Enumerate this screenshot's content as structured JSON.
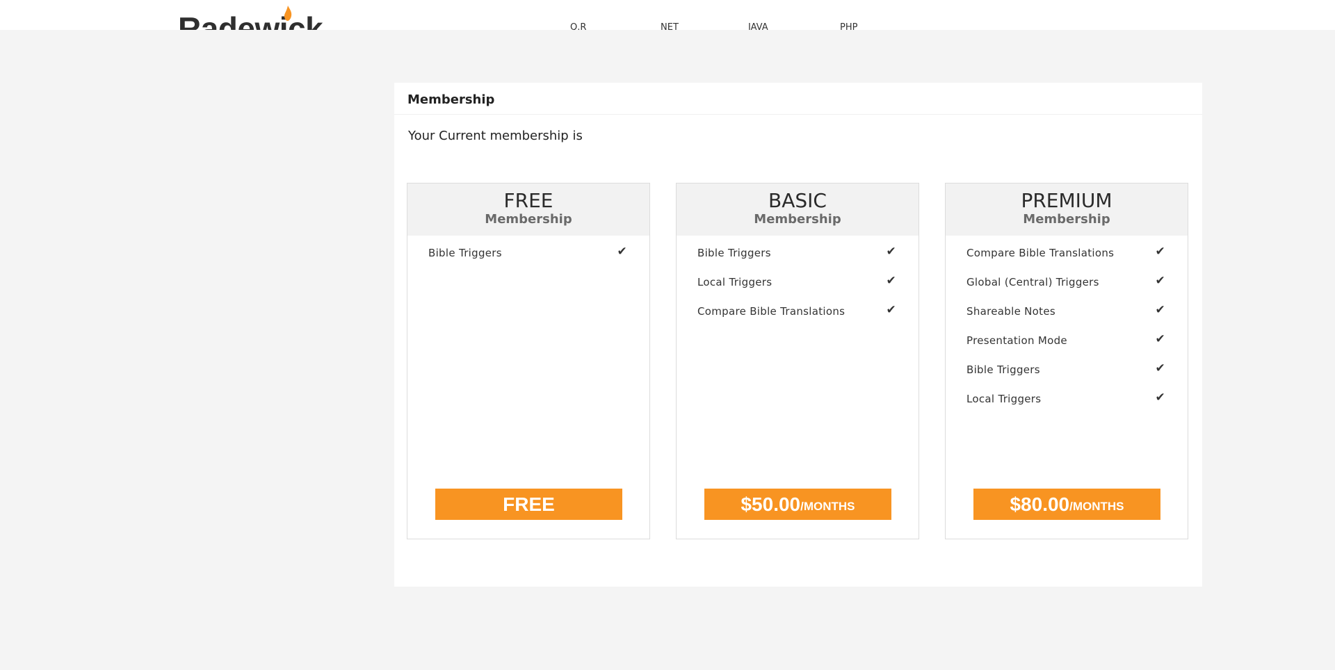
{
  "header": {
    "logo_text": "Radewick",
    "nav": [
      "Q.R",
      "NET",
      "JAVA",
      "PHP"
    ]
  },
  "panel": {
    "title": "Membership",
    "current_text": "Your Current membership is"
  },
  "plans": [
    {
      "name": "FREE",
      "subtitle": "Membership",
      "features": [
        "Bible Triggers"
      ],
      "price": "FREE",
      "unit": ""
    },
    {
      "name": "BASIC",
      "subtitle": "Membership",
      "features": [
        "Bible Triggers",
        "Local Triggers",
        "Compare Bible Translations"
      ],
      "price": "$50.00",
      "unit": "/MONTHS"
    },
    {
      "name": "PREMIUM",
      "subtitle": "Membership",
      "features": [
        "Compare Bible Translations",
        "Global (Central) Triggers",
        "Shareable Notes",
        "Presentation Mode",
        "Bible Triggers",
        "Local Triggers"
      ],
      "price": "$80.00",
      "unit": "/MONTHS"
    }
  ],
  "icons": {
    "feature_check": "check-icon",
    "logo_flame": "flame-icon"
  },
  "colors": {
    "accent": "#f89422",
    "background": "#f4f4f4"
  }
}
